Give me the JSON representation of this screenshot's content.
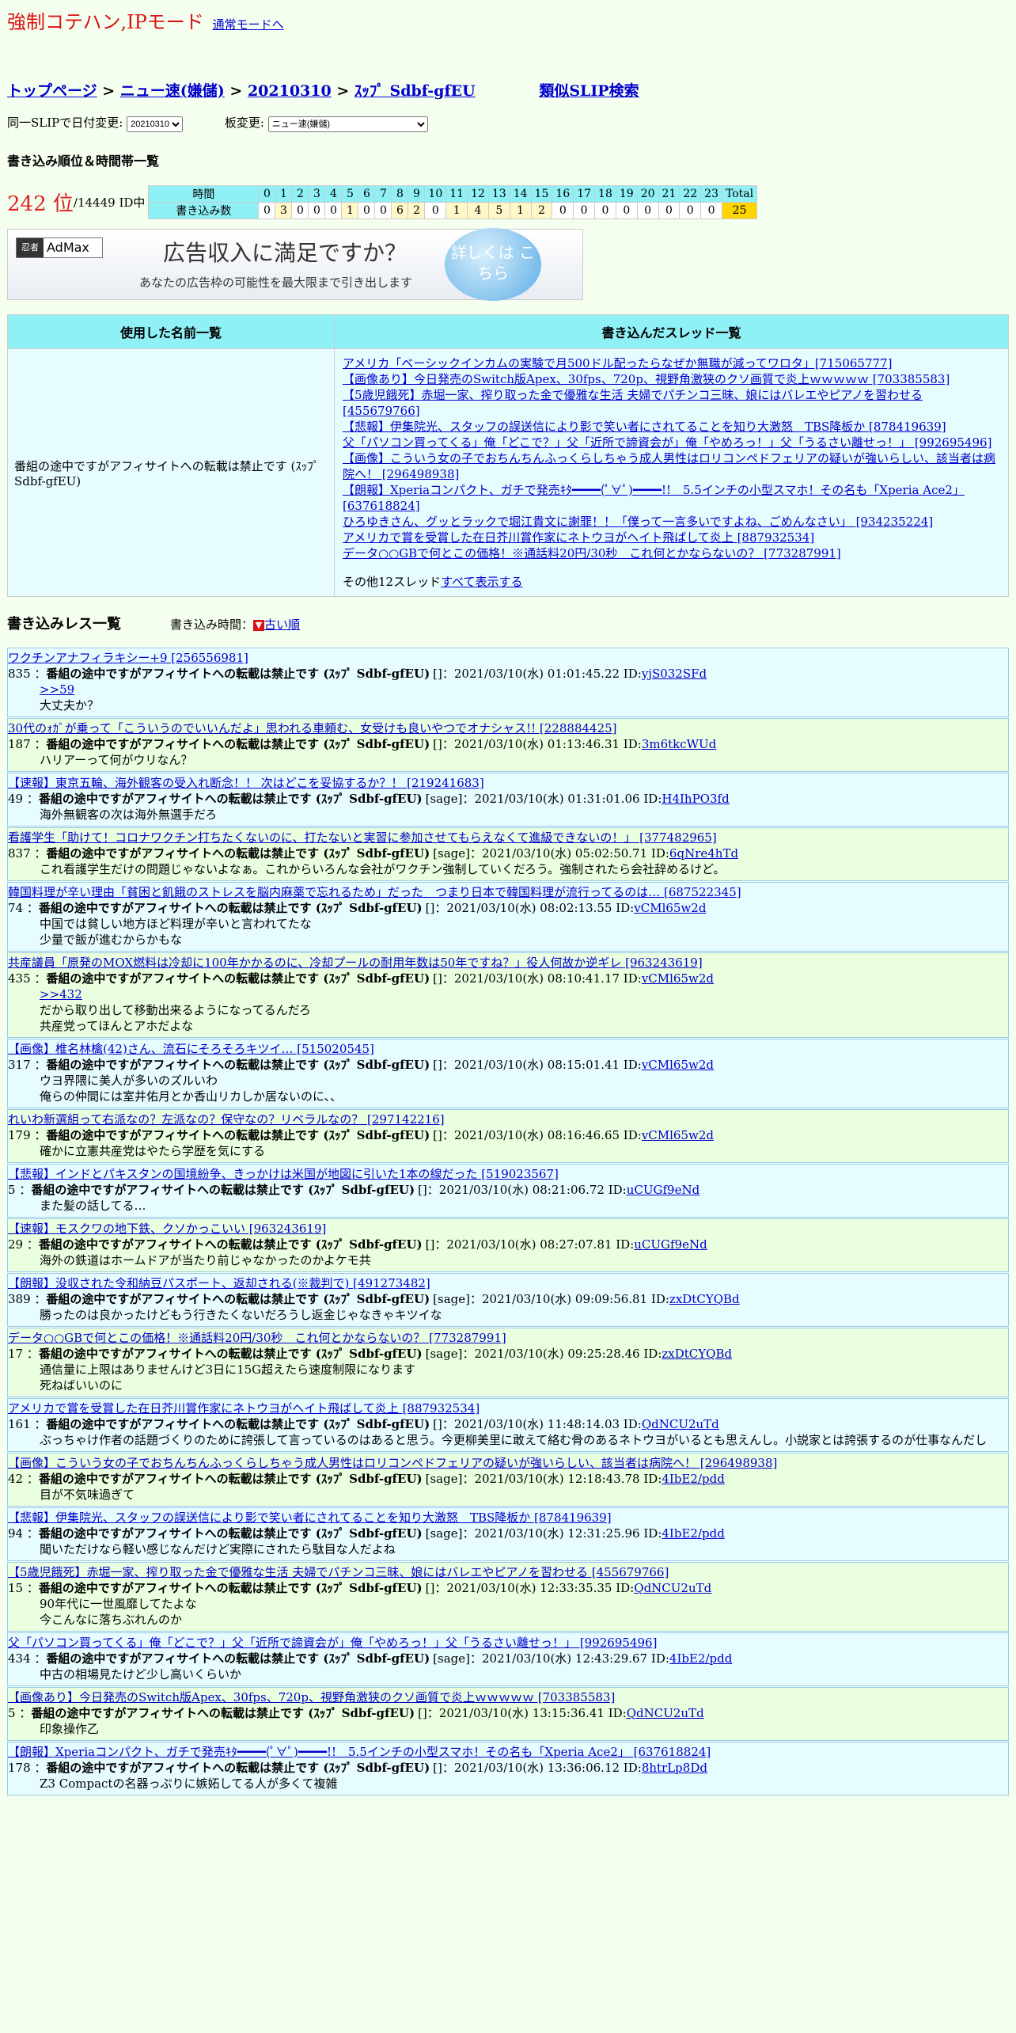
{
  "header": {
    "title": "強制コテハン,IPモード",
    "normal_mode_link": "通常モードへ"
  },
  "breadcrumb": {
    "top": "トップページ",
    "board": "ニュー速(嫌儲)",
    "date": "20210310",
    "slip": "ｽｯﾌﾟ Sdbf-gfEU",
    "sep": ">",
    "similar": "類似SLIP検索"
  },
  "selects": {
    "date_label": "同一SLIPで日付変更:",
    "date_value": "20210310",
    "board_label": "板変更:",
    "board_value": "ニュー速(嫌儲)"
  },
  "ranking": {
    "section_title": "書き込み順位＆時間帯一覧",
    "rank": "242 位",
    "total": "/14449 ID中",
    "time_label": "時間",
    "count_label": "書き込み数",
    "hours": [
      "0",
      "1",
      "2",
      "3",
      "4",
      "5",
      "6",
      "7",
      "8",
      "9",
      "10",
      "11",
      "12",
      "13",
      "14",
      "15",
      "16",
      "17",
      "18",
      "19",
      "20",
      "21",
      "22",
      "23",
      "Total"
    ],
    "counts": [
      0,
      3,
      0,
      0,
      0,
      1,
      0,
      0,
      6,
      2,
      0,
      1,
      4,
      5,
      1,
      2,
      0,
      0,
      0,
      0,
      0,
      0,
      0,
      0,
      25
    ]
  },
  "ad": {
    "logo_a": "忍者",
    "logo_b": "AdMax",
    "headline": "広告収入に満足ですか？",
    "sub": "あなたの広告枠の可能性を最大限まで引き出します",
    "button": "詳しくは こちら"
  },
  "names_table": {
    "col_names": "使用した名前一覧",
    "col_threads": "書き込んだスレッド一覧",
    "name": "番組の途中ですがアフィサイトへの転載は禁止です (ｽｯﾌﾟ Sdbf-gfEU)",
    "threads": [
      "アメリカ「ベーシックインカムの実験で月500ドル配ったらなぜか無職が減ってワロタ」[715065777]",
      "【画像あり】今日発売のSwitch版Apex、30fps、720p、視野角激狭のクソ画質で炎上ｗｗｗｗｗ [703385583]",
      "【5歳児餓死】赤堀一家、搾り取った金で優雅な生活 夫婦でパチンコ三昧、娘にはバレエやピアノを習わせる [455679766]",
      "【悲報】伊集院光、スタッフの誤送信により影で笑い者にされてることを知り大激怒　TBS降板か [878419639]",
      "父「パソコン買ってくる」俺「どこで？」父「近所で諦資会が」俺「やめろっ！」父「うるさい離せっ！」 [992695496]",
      "【画像】こういう女の子でおちんちんふっくらしちゃう成人男性はロリコンペドフェリアの疑いが強いらしい、該当者は病院へ！ [296498938]",
      "【朗報】Xperiaコンパクト、ガチで発売ｷﾀ━━━━(ﾟ∀ﾟ)━━━━!!　5.5インチの小型スマホ！その名も「Xperia Ace2」 [637618824]",
      "ひろゆきさん、グッとラックで堀江貴文に謝罪！！「僕って一言多いですよね、ごめんなさい」 [934235224]",
      "アメリカで賞を受賞した在日芥川賞作家にネトウヨがヘイト飛ばして炎上 [887932534]",
      "データ○○GBで何とこの価格！※通話料20円/30秒　これ何とかならないの？ [773287991]"
    ],
    "more_prefix": "その他12スレッド",
    "more_link": "すべて表示する"
  },
  "posts_section": {
    "title": "書き込みレス一覧",
    "order_label": "書き込み時間：",
    "order_icon": "▼",
    "order_link": "古い順"
  },
  "posts": [
    {
      "title": "ワクチンアナフィラキシー+9 [256556981]",
      "num": "835",
      "name": "番組の途中ですがアフィサイトへの転載は禁止です (ｽｯﾌﾟ Sdbf-gfEU)",
      "meta": "[]：2021/03/10(水) 01:01:45.22 ID:",
      "id": "yjS032SFd",
      "lines": [
        ">>59",
        "大丈夫か？"
      ]
    },
    {
      "title": "30代のｫｶﾞが乗って「こういうのでいいんだよ」思われる車頼む、女受けも良いやつでオナシャス!! [228884425]",
      "num": "187",
      "name": "番組の途中ですがアフィサイトへの転載は禁止です (ｽｯﾌﾟ Sdbf-gfEU)",
      "meta": "[]：2021/03/10(水) 01:13:46.31 ID:",
      "id": "3m6tkcWUd",
      "lines": [
        "ハリアーって何がウリなん？"
      ]
    },
    {
      "title": "【速報】東京五輪、海外観客の受入れ断念！！ 次はどこを妥協するか？！ [219241683]",
      "num": "49",
      "name": "番組の途中ですがアフィサイトへの転載は禁止です (ｽｯﾌﾟ Sdbf-gfEU)",
      "meta": "[sage]：2021/03/10(水) 01:31:01.06 ID:",
      "id": "H4IhPO3fd",
      "lines": [
        "海外無観客の次は海外無選手だろ"
      ]
    },
    {
      "title": "看護学生「助けて！コロナワクチン打ちたくないのに、打たないと実習に参加させてもらえなくて進級できないの！」 [377482965]",
      "num": "837",
      "name": "番組の途中ですがアフィサイトへの転載は禁止です (ｽｯﾌﾟ Sdbf-gfEU)",
      "meta": "[sage]：2021/03/10(水) 05:02:50.71 ID:",
      "id": "6qNre4hTd",
      "lines": [
        "これ看護学生だけの問題じゃないよなぁ。これからいろんな会社がワクチン強制していくだろう。強制されたら会社辞めるけど。"
      ]
    },
    {
      "title": "韓国料理が辛い理由「貧困と飢餓のストレスを脳内麻薬で忘れるため」だった　つまり日本で韓国料理が流行ってるのは… [687522345]",
      "num": "74",
      "name": "番組の途中ですがアフィサイトへの転載は禁止です (ｽｯﾌﾟ Sdbf-gfEU)",
      "meta": "[]：2021/03/10(水) 08:02:13.55 ID:",
      "id": "vCMl65w2d",
      "lines": [
        "中国では貧しい地方ほど料理が辛いと言われてたな",
        "少量で飯が進むからかもな"
      ]
    },
    {
      "title": "共産議員「原発のMOX燃料は冷却に100年かかるのに、冷却プールの耐用年数は50年ですね？」役人何故か逆ギレ [963243619]",
      "num": "435",
      "name": "番組の途中ですがアフィサイトへの転載は禁止です (ｽｯﾌﾟ Sdbf-gfEU)",
      "meta": "[]：2021/03/10(水) 08:10:41.17 ID:",
      "id": "vCMl65w2d",
      "lines": [
        ">>432",
        "だから取り出して移動出来るようになってるんだろ",
        "共産党ってほんとアホだよな"
      ]
    },
    {
      "title": "【画像】椎名林檎(42)さん、流石にそろそろキツイ… [515020545]",
      "num": "317",
      "name": "番組の途中ですがアフィサイトへの転載は禁止です (ｽｯﾌﾟ Sdbf-gfEU)",
      "meta": "[]：2021/03/10(水) 08:15:01.41 ID:",
      "id": "vCMl65w2d",
      "lines": [
        "ウヨ界隈に美人が多いのズルいわ",
        "俺らの仲間には室井佑月とか香山リカしか居ないのに、、"
      ]
    },
    {
      "title": "れいわ新選組って右派なの？左派なの？保守なの？リベラルなの？ [297142216]",
      "num": "179",
      "name": "番組の途中ですがアフィサイトへの転載は禁止です (ｽｯﾌﾟ Sdbf-gfEU)",
      "meta": "[]：2021/03/10(水) 08:16:46.65 ID:",
      "id": "vCMl65w2d",
      "lines": [
        "確かに立憲共産党はやたら学歴を気にする"
      ]
    },
    {
      "title": "【悲報】インドとパキスタンの国境紛争、きっかけは米国が地図に引いた1本の線だった [519023567]",
      "num": "5",
      "name": "番組の途中ですがアフィサイトへの転載は禁止です (ｽｯﾌﾟ Sdbf-gfEU)",
      "meta": "[]：2021/03/10(水) 08:21:06.72 ID:",
      "id": "uCUGf9eNd",
      "lines": [
        "また髪の話してる…"
      ]
    },
    {
      "title": "【速報】モスクワの地下鉄、クソかっこいい [963243619]",
      "num": "29",
      "name": "番組の途中ですがアフィサイトへの転載は禁止です (ｽｯﾌﾟ Sdbf-gfEU)",
      "meta": "[]：2021/03/10(水) 08:27:07.81 ID:",
      "id": "uCUGf9eNd",
      "lines": [
        "海外の鉄道はホームドアが当たり前じゃなかったのかよケモ共"
      ]
    },
    {
      "title": "【朗報】没収された令和納豆パスポート、返却される(※裁判で) [491273482]",
      "num": "389",
      "name": "番組の途中ですがアフィサイトへの転載は禁止です (ｽｯﾌﾟ Sdbf-gfEU)",
      "meta": "[sage]：2021/03/10(水) 09:09:56.81 ID:",
      "id": "zxDtCYQBd",
      "lines": [
        "勝ったのは良かったけどもう行きたくないだろうし返金じゃなきゃキツイな"
      ]
    },
    {
      "title": "データ○○GBで何とこの価格！※通話料20円/30秒　これ何とかならないの？ [773287991]",
      "num": "17",
      "name": "番組の途中ですがアフィサイトへの転載は禁止です (ｽｯﾌﾟ Sdbf-gfEU)",
      "meta": "[sage]：2021/03/10(水) 09:25:28.46 ID:",
      "id": "zxDtCYQBd",
      "lines": [
        "通信量に上限はありませんけど3日に15G超えたら速度制限になります",
        "死ねばいいのに"
      ]
    },
    {
      "title": "アメリカで賞を受賞した在日芥川賞作家にネトウヨがヘイト飛ばして炎上 [887932534]",
      "num": "161",
      "name": "番組の途中ですがアフィサイトへの転載は禁止です (ｽｯﾌﾟ Sdbf-gfEU)",
      "meta": "[]：2021/03/10(水) 11:48:14.03 ID:",
      "id": "QdNCU2uTd",
      "lines": [
        "ぶっちゃけ作者の話題づくりのために誇張して言っているのはあると思う。今更柳美里に敢えて絡む骨のあるネトウヨがいるとも思えんし。小説家とは誇張するのが仕事なんだし"
      ]
    },
    {
      "title": "【画像】こういう女の子でおちんちんふっくらしちゃう成人男性はロリコンペドフェリアの疑いが強いらしい、該当者は病院へ！ [296498938]",
      "num": "42",
      "name": "番組の途中ですがアフィサイトへの転載は禁止です (ｽｯﾌﾟ Sdbf-gfEU)",
      "meta": "[sage]：2021/03/10(水) 12:18:43.78 ID:",
      "id": "4IbE2/pdd",
      "lines": [
        "目が不気味過ぎて"
      ]
    },
    {
      "title": "【悲報】伊集院光、スタッフの誤送信により影で笑い者にされてることを知り大激怒　TBS降板か [878419639]",
      "num": "94",
      "name": "番組の途中ですがアフィサイトへの転載は禁止です (ｽｯﾌﾟ Sdbf-gfEU)",
      "meta": "[sage]：2021/03/10(水) 12:31:25.96 ID:",
      "id": "4IbE2/pdd",
      "lines": [
        "聞いただけなら軽い感じなんだけど実際にされたら駄目な人だよね"
      ]
    },
    {
      "title": "【5歳児餓死】赤堀一家、搾り取った金で優雅な生活 夫婦でパチンコ三昧、娘にはバレエやピアノを習わせる [455679766]",
      "num": "15",
      "name": "番組の途中ですがアフィサイトへの転載は禁止です (ｽｯﾌﾟ Sdbf-gfEU)",
      "meta": "[]：2021/03/10(水) 12:33:35.35 ID:",
      "id": "QdNCU2uTd",
      "lines": [
        "90年代に一世風靡してたよな",
        "今こんなに落ちぶれんのか"
      ]
    },
    {
      "title": "父「パソコン買ってくる」俺「どこで？」父「近所で諦資会が」俺「やめろっ！」父「うるさい離せっ！」 [992695496]",
      "num": "434",
      "name": "番組の途中ですがアフィサイトへの転載は禁止です (ｽｯﾌﾟ Sdbf-gfEU)",
      "meta": "[sage]：2021/03/10(水) 12:43:29.67 ID:",
      "id": "4IbE2/pdd",
      "lines": [
        "中古の相場見たけど少し高いくらいか"
      ]
    },
    {
      "title": "【画像あり】今日発売のSwitch版Apex、30fps、720p、視野角激狭のクソ画質で炎上ｗｗｗｗｗ [703385583]",
      "num": "5",
      "name": "番組の途中ですがアフィサイトへの転載は禁止です (ｽｯﾌﾟ Sdbf-gfEU)",
      "meta": "[]：2021/03/10(水) 13:15:36.41 ID:",
      "id": "QdNCU2uTd",
      "lines": [
        "印象操作乙"
      ]
    },
    {
      "title": "【朗報】Xperiaコンパクト、ガチで発売ｷﾀ━━━━(ﾟ∀ﾟ)━━━━!!　5.5インチの小型スマホ！その名も「Xperia Ace2」 [637618824]",
      "num": "178",
      "name": "番組の途中ですがアフィサイトへの転載は禁止です (ｽｯﾌﾟ Sdbf-gfEU)",
      "meta": "[]：2021/03/10(水) 13:36:06.12 ID:",
      "id": "8htrLp8Dd",
      "lines": [
        "Z3 Compactの名器っぷりに嫉妬してる人が多くて複雑"
      ]
    }
  ]
}
